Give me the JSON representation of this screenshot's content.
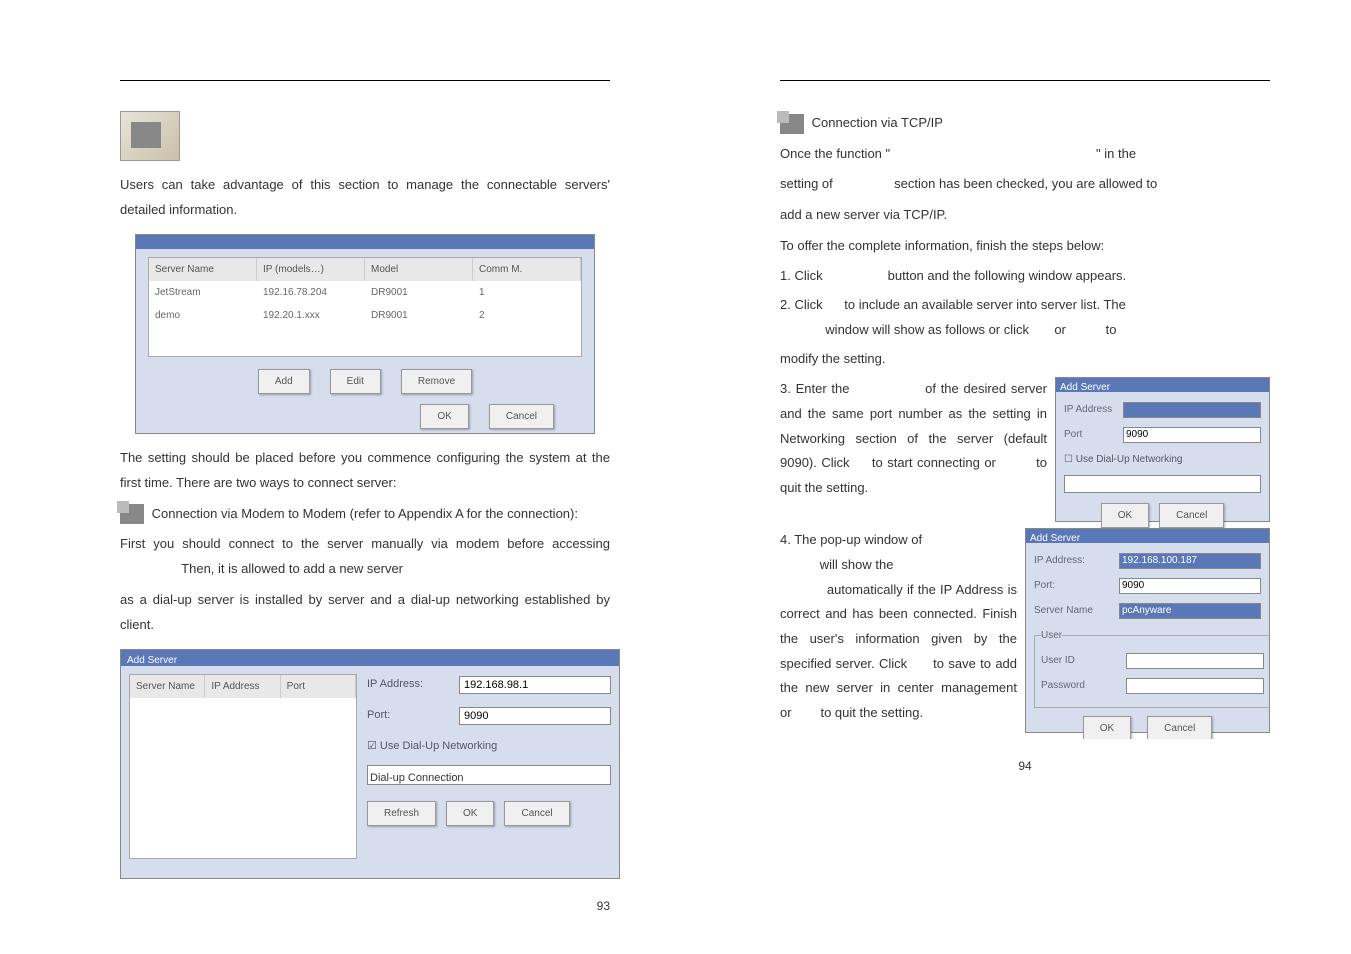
{
  "left": {
    "intro": "Users can take advantage of this section to manage the connectable servers' detailed information.",
    "sc1": {
      "cols": [
        "Server Name",
        "IP (models…)",
        "Model",
        "Comm M."
      ],
      "row1": [
        "JetStream",
        "192.16.78.204",
        "DR9001",
        "1"
      ],
      "row2": [
        "demo",
        "192.20.1.xxx",
        "DR9001",
        "2"
      ],
      "btns": [
        "Add",
        "Edit",
        "Remove"
      ],
      "btns2": [
        "OK",
        "Cancel"
      ]
    },
    "para1": "The setting should be placed before you commence configuring the system at the first time.  There are two ways to connect server:",
    "mode1": "Connection via Modem to Modem (refer to Appendix A for the connection):",
    "para2a": "First you should connect to the server manually via modem before accessing",
    "para2b": "Then, it is allowed to add a new server",
    "para3": "as a dial-up server is installed by server and a dial-up networking established by client.",
    "sc2": {
      "title": "Add Server",
      "cols": [
        "Server Name",
        "IP Address",
        "Port"
      ],
      "labels": {
        "ip": "IP Address:",
        "port": "Port:"
      },
      "ip": "192.168.98.1",
      "port": "9090",
      "cb": "Use Dial-Up Networking",
      "combo": "Dial-up Connection",
      "btns": [
        "Refresh",
        "OK",
        "Cancel"
      ]
    },
    "pagenum": "93"
  },
  "right": {
    "mode2": "Connection via TCP/IP",
    "para1a": "Once the function \"",
    "para1b": "\" in the",
    "para2": "setting of",
    "para2b": "section has been checked, you are allowed to",
    "para3": "add a new server via TCP/IP.",
    "para4": "To offer the complete information, finish the steps below:",
    "li1a": "1.  Click",
    "li1b": "button and the following window appears.",
    "li2a": "2.  Click",
    "li2b": "to include an available server into server list. The",
    "li2c": "window will show as follows or click",
    "li2d": "or",
    "li2e": "to",
    "li2f": "modify the setting.",
    "li3a": "3.  Enter the",
    "li3b": "of the desired server and the same port number as the setting in Networking section of the server (default 9090). Click",
    "li3c": "to start connecting or",
    "li3d": "to quit the setting.",
    "sc3": {
      "title": "Add Server",
      "labels": {
        "ip": "IP Address",
        "port": "Port"
      },
      "ipval": "",
      "portval": "9090",
      "cb": "Use Dial-Up Networking",
      "btns": [
        "OK",
        "Cancel"
      ]
    },
    "li4a": "4.  The pop-up window of",
    "li4b": "will show the",
    "li4c": "automatically if the IP Address is correct and has been connected. Finish the user's information given by the specified server. Click",
    "li4d": "to save to add the new server in center management or",
    "li4e": "to quit the setting.",
    "sc4": {
      "title": "Add Server",
      "labels": {
        "ip": "IP Address:",
        "port": "Port:",
        "sn": "Server Name",
        "uid": "User ID",
        "pw": "Password"
      },
      "ipval": "192.168.100.187",
      "portval": "9090",
      "snval": "pcAnyware",
      "legend": "User",
      "btns": [
        "OK",
        "Cancel"
      ]
    },
    "pagenum": "94"
  }
}
